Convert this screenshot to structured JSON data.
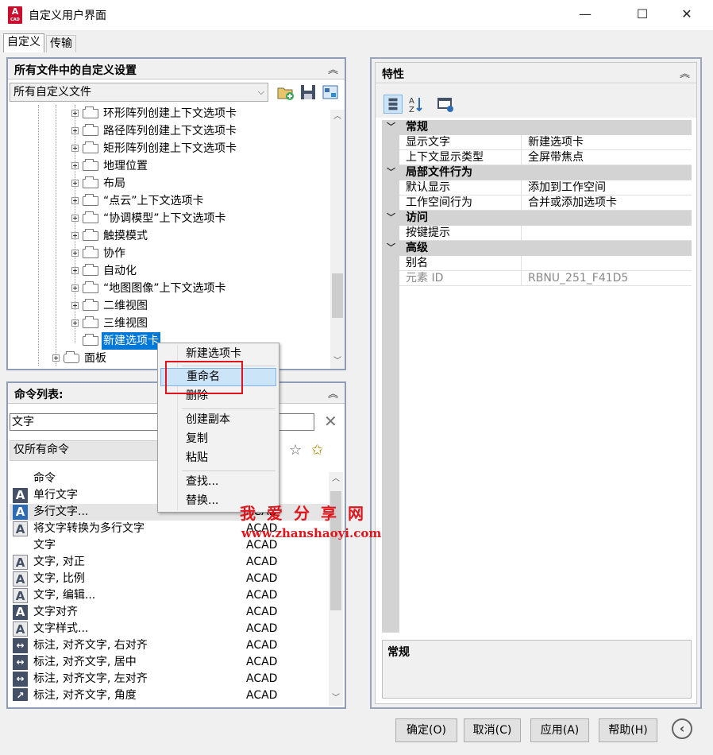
{
  "window": {
    "title": "自定义用户界面",
    "minimize": "—",
    "maximize": "☐",
    "close": "✕",
    "icon_letter": "A",
    "icon_sub": "CAD"
  },
  "tabs": [
    {
      "label": "自定义"
    },
    {
      "label": "传输"
    }
  ],
  "left_top": {
    "header": "所有文件中的自定义设置",
    "combo_value": "所有自定义文件",
    "tree": [
      {
        "label": "环形阵列创建上下文选项卡"
      },
      {
        "label": "路径阵列创建上下文选项卡"
      },
      {
        "label": "矩形阵列创建上下文选项卡"
      },
      {
        "label": "地理位置"
      },
      {
        "label": "布局"
      },
      {
        "label": "“点云”上下文选项卡"
      },
      {
        "label": "“协调模型”上下文选项卡"
      },
      {
        "label": "触摸模式"
      },
      {
        "label": "协作"
      },
      {
        "label": "自动化"
      },
      {
        "label": "“地图图像”上下文选项卡"
      },
      {
        "label": "二维视图"
      },
      {
        "label": "三维视图"
      },
      {
        "label": "新建选项卡"
      }
    ],
    "panel_node": "面板"
  },
  "left_bottom": {
    "header": "命令列表:",
    "search_value": "文字",
    "filter_value": "仅所有命令",
    "columns": {
      "name": "命令",
      "source": ""
    },
    "rows": [
      {
        "name": "单行文字",
        "source": "",
        "icon": "A"
      },
      {
        "name": "多行文字...",
        "source": "ACAD",
        "icon": "A"
      },
      {
        "name": "将文字转换为多行文字",
        "source": "ACAD",
        "icon": "A"
      },
      {
        "name": "文字",
        "source": "ACAD",
        "icon": ""
      },
      {
        "name": "文字, 对正",
        "source": "ACAD",
        "icon": "A"
      },
      {
        "name": "文字, 比例",
        "source": "ACAD",
        "icon": "A"
      },
      {
        "name": "文字, 编辑...",
        "source": "ACAD",
        "icon": "A"
      },
      {
        "name": "文字对齐",
        "source": "ACAD",
        "icon": "A"
      },
      {
        "name": "文字样式...",
        "source": "ACAD",
        "icon": "A"
      },
      {
        "name": "标注, 对齐文字, 右对齐",
        "source": "ACAD",
        "icon": "↔"
      },
      {
        "name": "标注, 对齐文字, 居中",
        "source": "ACAD",
        "icon": "↔"
      },
      {
        "name": "标注, 对齐文字, 左对齐",
        "source": "ACAD",
        "icon": "↔"
      },
      {
        "name": "标注, 对齐文字, 角度",
        "source": "ACAD",
        "icon": "↗"
      }
    ]
  },
  "context_menu": {
    "items": [
      {
        "label": "新建选项卡"
      },
      {
        "label": "重命名"
      },
      {
        "label": "删除"
      },
      {
        "label": "创建副本"
      },
      {
        "label": "复制"
      },
      {
        "label": "粘贴"
      },
      {
        "label": "查找..."
      },
      {
        "label": "替换..."
      }
    ]
  },
  "properties": {
    "header": "特性",
    "categories": [
      {
        "name": "常规"
      },
      {
        "name": "局部文件行为"
      },
      {
        "name": "访问"
      },
      {
        "name": "高级"
      }
    ],
    "rows": [
      {
        "name": "显示文字",
        "value": "新建选项卡"
      },
      {
        "name": "上下文显示类型",
        "value": "全屏带焦点"
      },
      {
        "name": "默认显示",
        "value": "添加到工作空间"
      },
      {
        "name": "工作空间行为",
        "value": "合并或添加选项卡"
      },
      {
        "name": "按键提示",
        "value": ""
      },
      {
        "name": "别名",
        "value": ""
      },
      {
        "name": "元素 ID",
        "value": "RBNU_251_F41D5"
      }
    ],
    "description_title": "常规"
  },
  "buttons": {
    "ok": "确定(O)",
    "cancel": "取消(C)",
    "apply": "应用(A)",
    "help": "帮助(H)",
    "collapse": "‹"
  },
  "watermark": {
    "cn": "我爱分享网",
    "url": "www.zhanshaoyi.com"
  }
}
